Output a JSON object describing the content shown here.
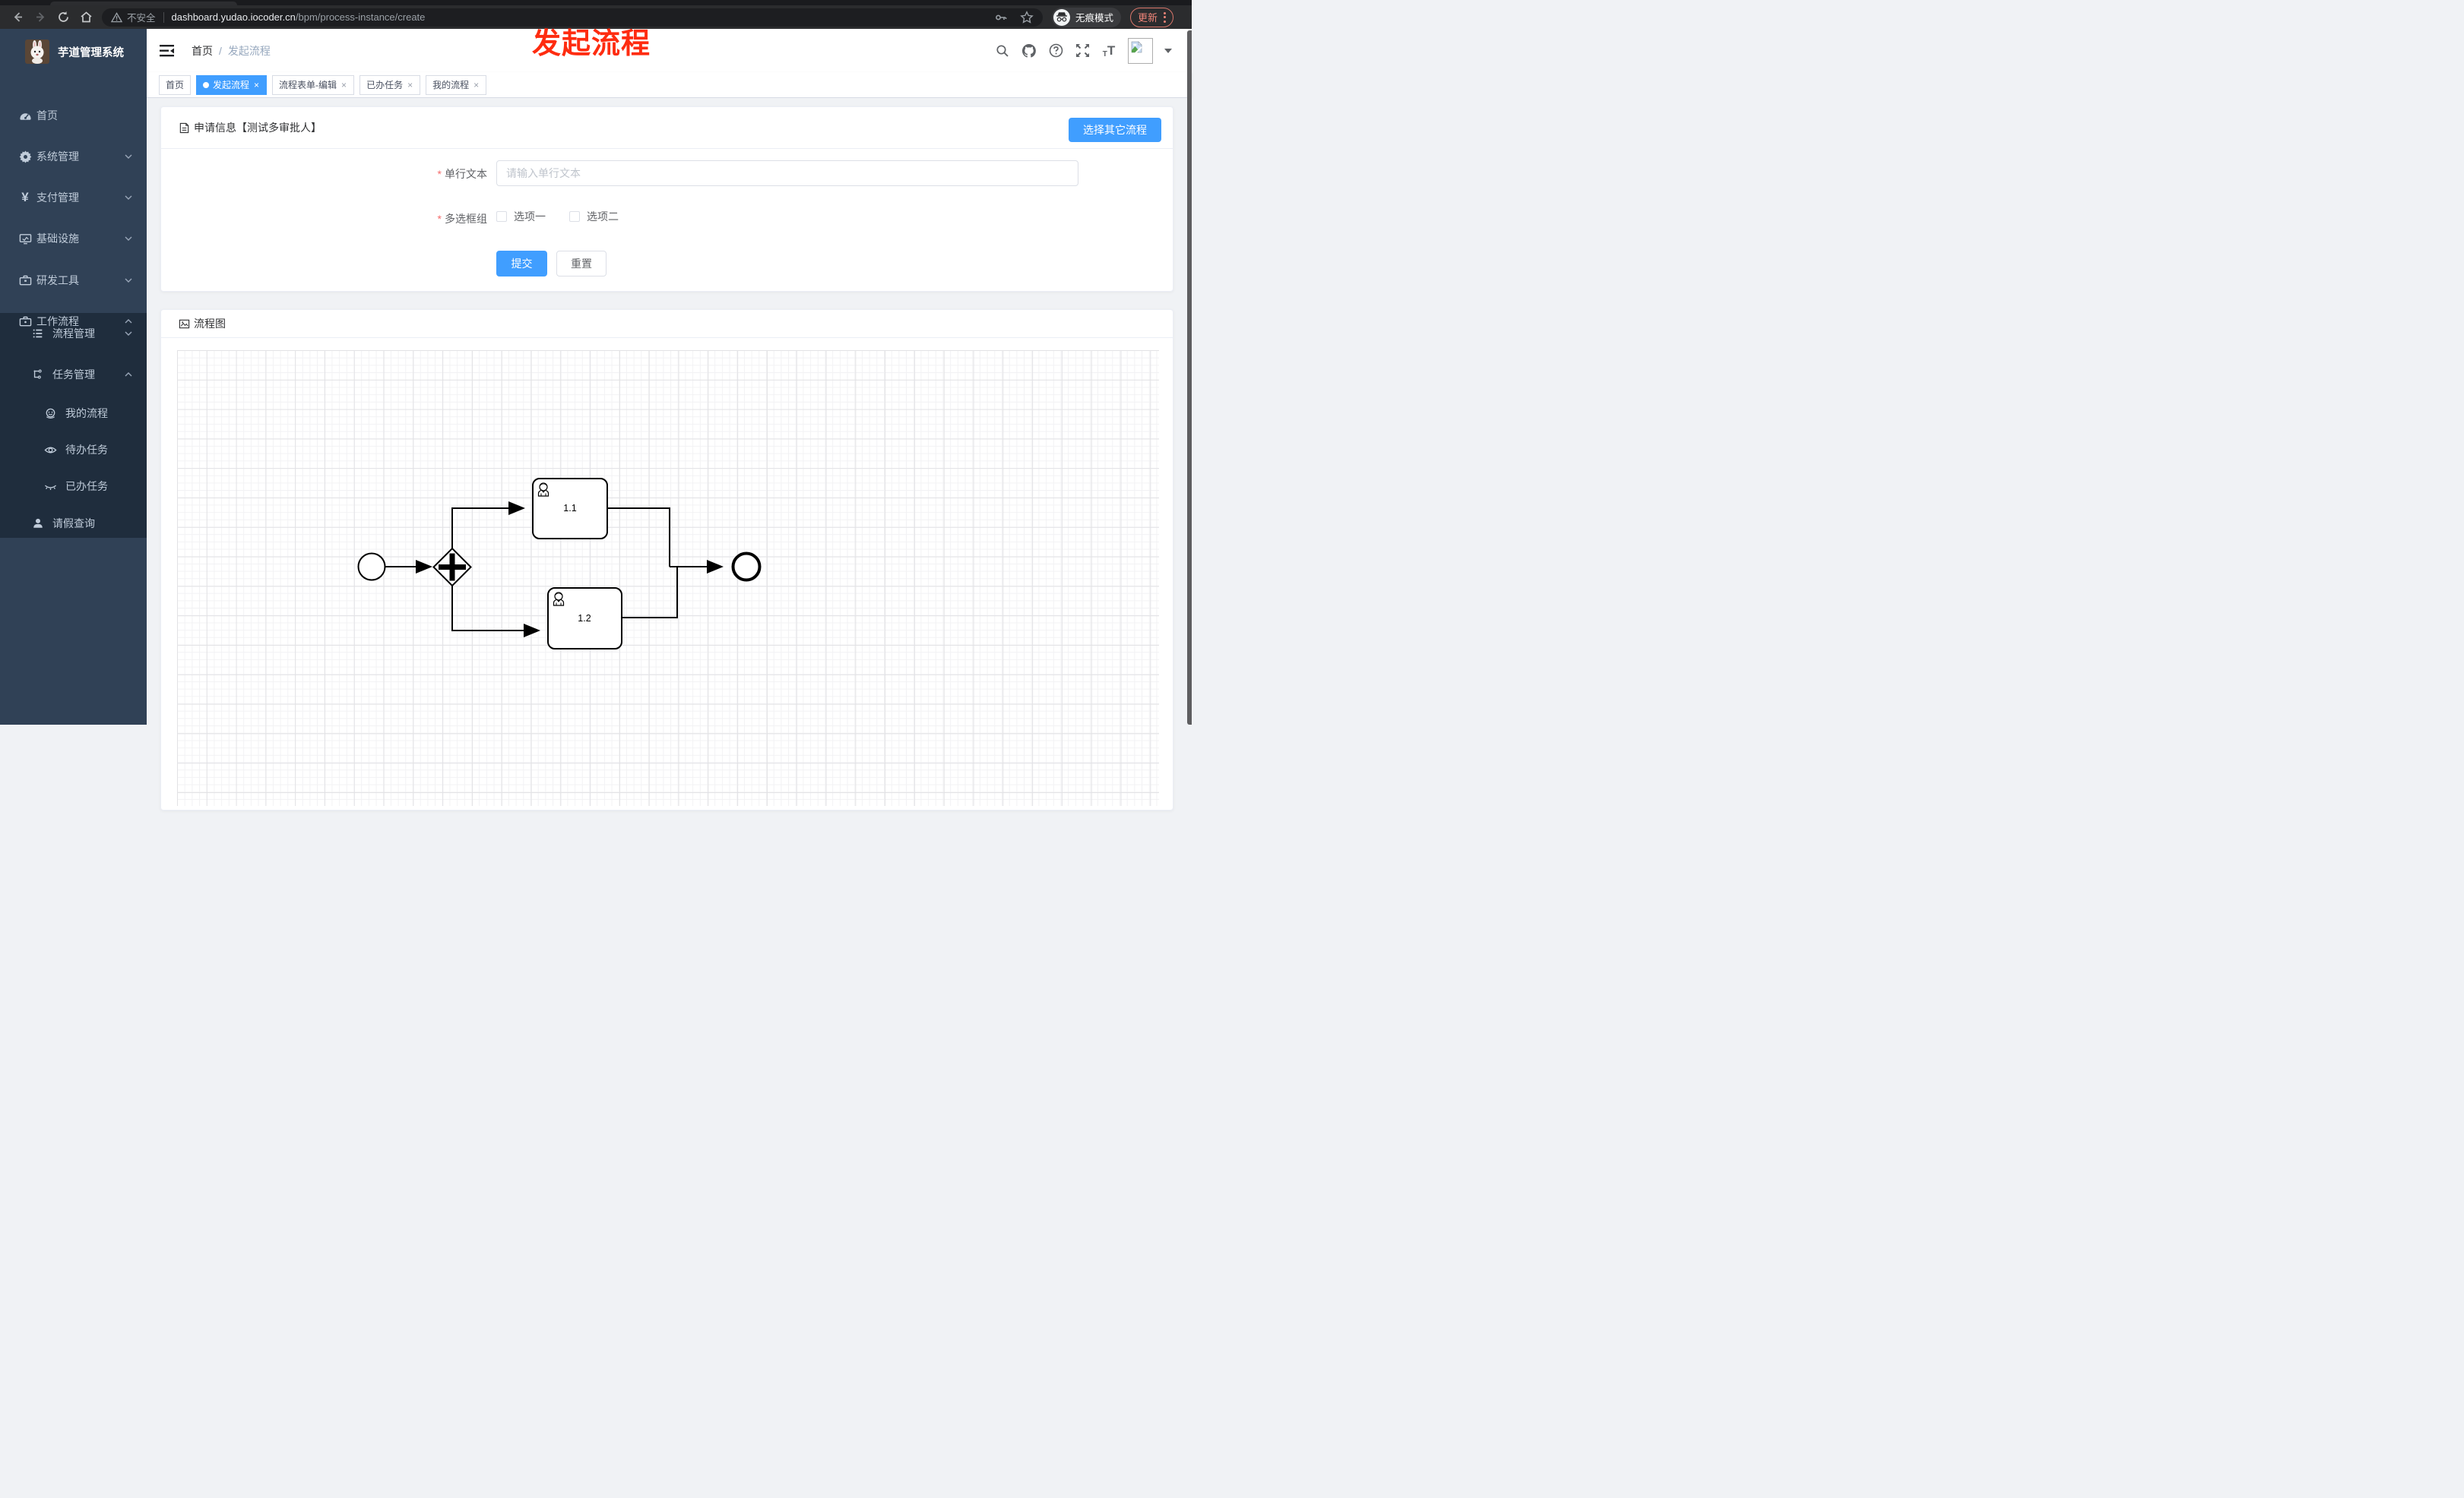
{
  "browser": {
    "security_label": "不安全",
    "url_domain": "dashboard.yudao.iocoder.cn",
    "url_path": "/bpm/process-instance/create",
    "incognito_label": "无痕模式",
    "update_label": "更新"
  },
  "annotation": {
    "text": "发起流程",
    "color": "#fe2c10"
  },
  "sidebar": {
    "title": "芋道管理系统",
    "items": [
      {
        "label": "首页",
        "icon": "dashboard-icon",
        "level": 1
      },
      {
        "label": "系统管理",
        "icon": "gear-icon",
        "level": 1,
        "chevron": "down"
      },
      {
        "label": "支付管理",
        "icon": "yen-icon",
        "level": 1,
        "chevron": "down",
        "icon_glyph": "¥"
      },
      {
        "label": "基础设施",
        "icon": "monitor-icon",
        "level": 1,
        "chevron": "down"
      },
      {
        "label": "研发工具",
        "icon": "toolbox-icon",
        "level": 1,
        "chevron": "down"
      },
      {
        "label": "工作流程",
        "icon": "briefcase-icon",
        "level": 1,
        "chevron": "up"
      },
      {
        "label": "流程管理",
        "icon": "flow-list-icon",
        "level": 2,
        "chevron": "down"
      },
      {
        "label": "任务管理",
        "icon": "task-tree-icon",
        "level": 2,
        "chevron": "up"
      },
      {
        "label": "我的流程",
        "icon": "face-icon",
        "level": 3
      },
      {
        "label": "待办任务",
        "icon": "eye-open-icon",
        "level": 3
      },
      {
        "label": "已办任务",
        "icon": "eye-closed-icon",
        "level": 3
      },
      {
        "label": "请假查询",
        "icon": "person-icon",
        "level": 2
      }
    ]
  },
  "header": {
    "breadcrumb": [
      "首页",
      "发起流程"
    ],
    "breadcrumb_separator": "/",
    "font_icon_big": "T",
    "font_icon_small": "T"
  },
  "tabbar": {
    "close_glyph": "×",
    "tabs": [
      {
        "label": "首页",
        "active": false,
        "closable": false
      },
      {
        "label": "发起流程",
        "active": true,
        "closable": true
      },
      {
        "label": "流程表单-编辑",
        "active": false,
        "closable": true
      },
      {
        "label": "已办任务",
        "active": false,
        "closable": true
      },
      {
        "label": "我的流程",
        "active": false,
        "closable": true
      }
    ]
  },
  "form_card": {
    "title": "申请信息【测试多审批人】",
    "select_other_button": "选择其它流程",
    "fields": [
      {
        "label": "单行文本",
        "required": true,
        "placeholder": "请输入单行文本",
        "value": ""
      },
      {
        "label": "多选框组",
        "required": true,
        "options": [
          {
            "label": "选项一",
            "checked": false
          },
          {
            "label": "选项二",
            "checked": false
          }
        ]
      }
    ],
    "submit_label": "提交",
    "reset_label": "重置"
  },
  "diagram_card": {
    "title": "流程图",
    "tasks": [
      {
        "label": "1.1"
      },
      {
        "label": "1.2"
      }
    ]
  },
  "colors": {
    "accent": "#409eff",
    "sidebar_bg": "#304156",
    "submenu_bg": "#1f2d3d",
    "annotation_red": "#fe2c10"
  }
}
